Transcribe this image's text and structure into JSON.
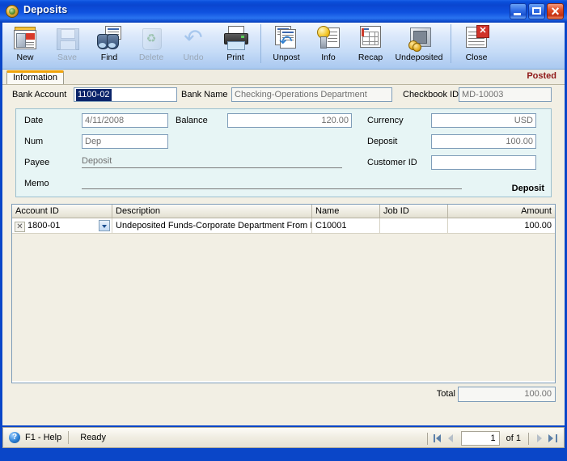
{
  "window": {
    "title": "Deposits",
    "icon": "app-globe-icon",
    "controls": {
      "minimize": "_",
      "maximize": "□",
      "close": "×"
    }
  },
  "toolbar": {
    "items": [
      {
        "label": "New",
        "icon": "new-document-icon",
        "disabled": false
      },
      {
        "label": "Save",
        "icon": "floppy-disk-icon",
        "disabled": true
      },
      {
        "label": "Find",
        "icon": "binoculars-icon",
        "disabled": false
      },
      {
        "label": "Delete",
        "icon": "recycle-bin-icon",
        "disabled": true
      },
      {
        "label": "Undo",
        "icon": "undo-arrow-icon",
        "disabled": true
      },
      {
        "label": "Print",
        "icon": "printer-icon",
        "disabled": false
      },
      {
        "label": "Unpost",
        "icon": "unpost-icon",
        "disabled": false
      },
      {
        "label": "Info",
        "icon": "info-lightbulb-icon",
        "disabled": false
      },
      {
        "label": "Recap",
        "icon": "recap-table-icon",
        "disabled": false
      },
      {
        "label": "Undeposited",
        "icon": "safe-coins-icon",
        "disabled": false
      },
      {
        "label": "Close",
        "icon": "close-document-icon",
        "disabled": false
      }
    ]
  },
  "tabs": {
    "information": "Information"
  },
  "status_label": "Posted",
  "form": {
    "bank_account_label": "Bank Account",
    "bank_account_value": "1100-02",
    "bank_name_label": "Bank Name",
    "bank_name_value": "Checking-Operations Department",
    "checkbook_id_label": "Checkbook ID",
    "checkbook_id_value": "MD-10003",
    "date_label": "Date",
    "date_value": "4/11/2008",
    "num_label": "Num",
    "num_value": "Dep",
    "payee_label": "Payee",
    "payee_value": "Deposit",
    "memo_label": "Memo",
    "memo_value": "",
    "balance_label": "Balance",
    "balance_value": "120.00",
    "currency_label": "Currency",
    "currency_value": "USD",
    "deposit_label": "Deposit",
    "deposit_value": "100.00",
    "customer_id_label": "Customer ID",
    "customer_id_value": "",
    "type_word": "Deposit"
  },
  "grid": {
    "columns": [
      "Account ID",
      "Description",
      "Name",
      "Job ID",
      "Amount"
    ],
    "rows": [
      {
        "account_id": "1800-01",
        "description": "Undeposited Funds-Corporate Department From R",
        "name": "C10001",
        "job_id": "",
        "amount": "100.00"
      }
    ]
  },
  "total": {
    "label": "Total",
    "value": "100.00"
  },
  "statusbar": {
    "help": "F1 - Help",
    "state": "Ready",
    "page_value": "1",
    "of_text": "of  1"
  }
}
